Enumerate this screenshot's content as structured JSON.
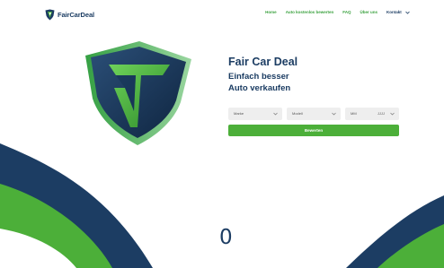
{
  "brand": {
    "name": "FairCarDeal"
  },
  "nav": {
    "items": [
      {
        "label": "Home"
      },
      {
        "label": "Auto kostenlos bewerten"
      },
      {
        "label": "FAQ"
      },
      {
        "label": "Über uns"
      },
      {
        "label": "Kontakt"
      }
    ]
  },
  "hero": {
    "title": "Fair Car Deal",
    "subtitle_line1": "Einfach besser",
    "subtitle_line2": "Auto verkaufen"
  },
  "form": {
    "make_label": "Marke",
    "model_label": "Modell",
    "year_label": "MM",
    "year_value": "JJJJ",
    "submit_label": "Bewerten"
  },
  "counter": {
    "value": "0"
  },
  "colors": {
    "navy": "#1c3d63",
    "green": "#4caf39",
    "nav_green": "#3aa13e",
    "field_bg": "#eeeeee"
  },
  "icons": {
    "brand_logo": "shield-logo-icon",
    "hero_logo": "shield-logo-icon",
    "dropdown": "chevron-down-icon"
  }
}
